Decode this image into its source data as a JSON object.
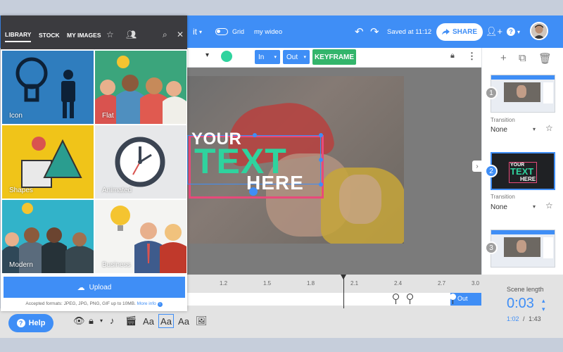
{
  "topbar": {
    "edit_fragment": "it",
    "grid_label": "Grid",
    "project_name": "my wideo",
    "saved_status": "Saved at 11:12",
    "share_label": "SHARE"
  },
  "toolbar": {
    "in_label": "In",
    "out_label": "Out",
    "keyframe_label": "KEYFRAME"
  },
  "canvas": {
    "line1": "YOUR",
    "line2": "TEXT",
    "line3": "HERE",
    "text_color": "#2fd39e"
  },
  "library": {
    "tabs": [
      "LIBRARY",
      "STOCK",
      "MY IMAGES"
    ],
    "tiles": [
      {
        "label": "Icon"
      },
      {
        "label": "Flat"
      },
      {
        "label": "Shapes"
      },
      {
        "label": "Animated"
      },
      {
        "label": "Modern"
      },
      {
        "label": "Business"
      }
    ],
    "upload_label": "Upload",
    "formats_text": "Accepted formats: JPEG, JPG, PNG, GIF up to 10MB.",
    "more_info": "More info"
  },
  "scenes": [
    {
      "number": "1",
      "transition_label": "Transition",
      "transition": "None"
    },
    {
      "number": "2",
      "transition_label": "Transition",
      "transition": "None",
      "thumb_line1": "YOUR",
      "thumb_line2": "TEXT",
      "thumb_line3": "HERE"
    },
    {
      "number": "3"
    }
  ],
  "timeline": {
    "ticks": [
      "1.2",
      "1.5",
      "1.8",
      "2.1",
      "2.4",
      "2.7",
      "3.0"
    ],
    "out_block": "Out"
  },
  "scene_length": {
    "label": "Scene length",
    "value": "0:03",
    "elapsed": "1:02",
    "separator": "/",
    "total": "1:43"
  },
  "bottom": {
    "help_label": "Help",
    "aa": [
      "Aa",
      "Aa",
      "Aa"
    ]
  },
  "colors": {
    "accent": "#3f8ef6",
    "keyframe": "#33b56b",
    "highlight": "#e84a7a"
  }
}
